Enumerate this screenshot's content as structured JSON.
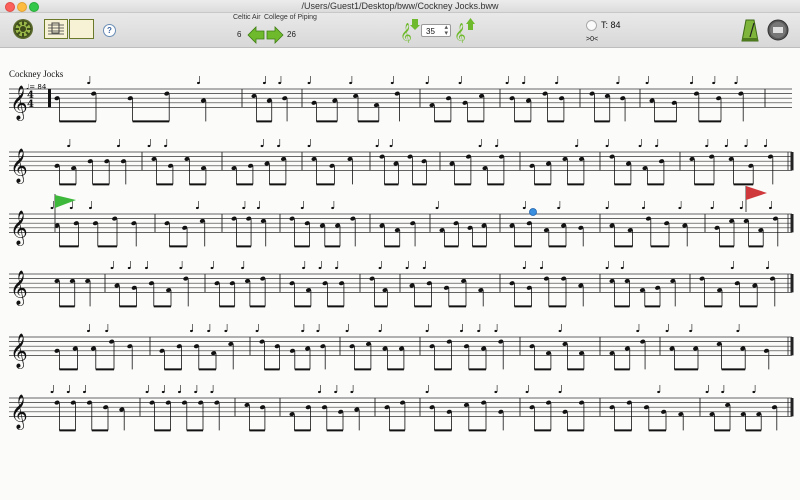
{
  "window": {
    "title": "/Users/Guest1/Desktop/bww/Cockney  Jocks.bww"
  },
  "toolbar": {
    "tune_type": "Celtic Air",
    "composer": "College of Piping",
    "prev_value": "6",
    "next_value": "26",
    "stepper_value": "35",
    "tempo_label": "T: 84",
    "transpose_label": ">0<",
    "help_label": "?"
  },
  "score": {
    "title": "Cockney Jocks",
    "tempo_marking": "♩= 84",
    "time_signature_top": "4",
    "time_signature_bottom": "4",
    "staves": 6
  },
  "colors": {
    "start_flag": "#3db83a",
    "end_flag": "#d0393c",
    "cursor": "#3b8fe0",
    "nav_arrow": "#6fba2c"
  }
}
